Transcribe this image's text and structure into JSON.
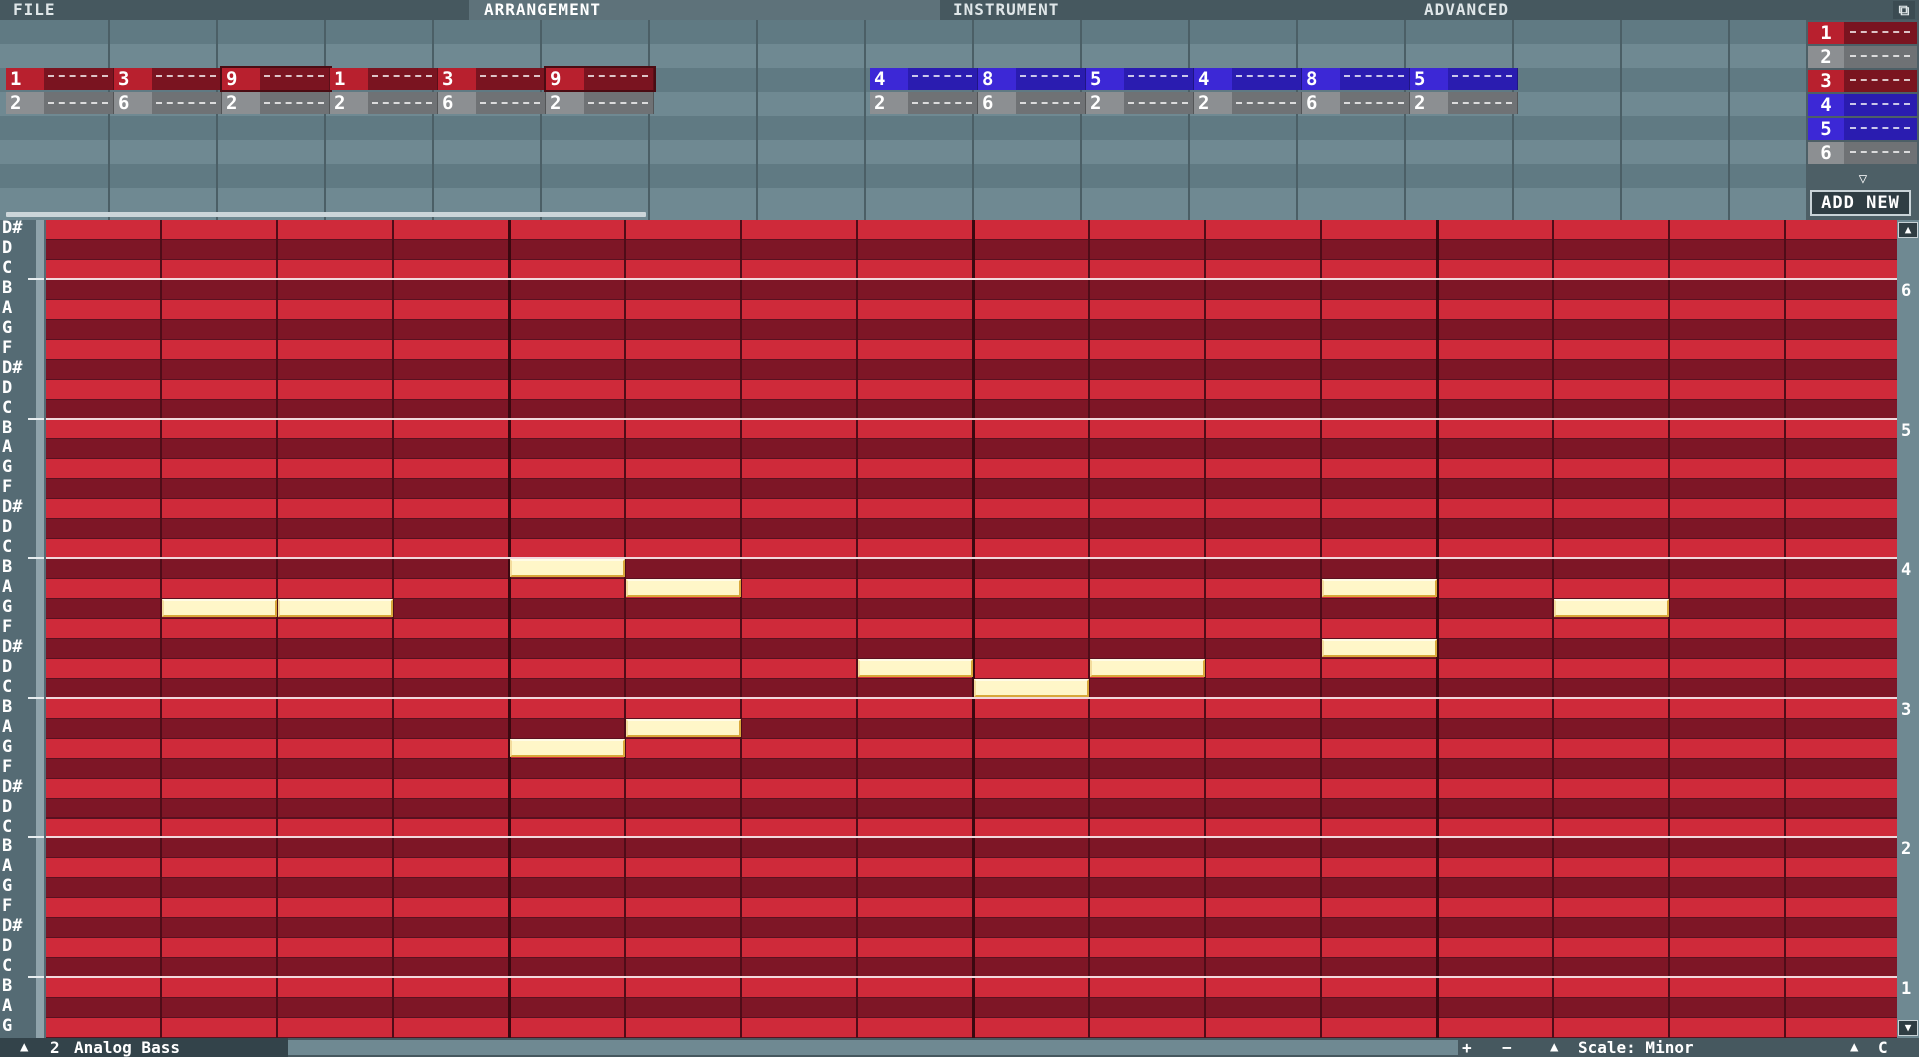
{
  "menu": {
    "tabs": [
      {
        "label": "FILE",
        "active": false
      },
      {
        "label": "ARRANGEMENT",
        "active": true
      },
      {
        "label": "INSTRUMENT",
        "active": false
      },
      {
        "label": "ADVANCED",
        "active": false
      }
    ],
    "window_icon": "maximize-icon"
  },
  "arrangement": {
    "rows": [
      [
        {
          "num": "1",
          "color": "red"
        },
        {
          "num": "3",
          "color": "red"
        },
        {
          "num": "9",
          "color": "red",
          "selected": true
        },
        {
          "num": "1",
          "color": "red"
        },
        {
          "num": "3",
          "color": "red"
        },
        {
          "num": "9",
          "color": "red",
          "selected": true
        },
        null,
        null,
        {
          "num": "4",
          "color": "blue"
        },
        {
          "num": "8",
          "color": "blue"
        },
        {
          "num": "5",
          "color": "blue"
        },
        {
          "num": "4",
          "color": "blue"
        },
        {
          "num": "8",
          "color": "blue"
        },
        {
          "num": "5",
          "color": "blue"
        }
      ],
      [
        {
          "num": "2",
          "color": "gray"
        },
        {
          "num": "6",
          "color": "gray"
        },
        {
          "num": "2",
          "color": "gray"
        },
        {
          "num": "2",
          "color": "gray"
        },
        {
          "num": "6",
          "color": "gray"
        },
        {
          "num": "2",
          "color": "gray"
        },
        null,
        null,
        {
          "num": "2",
          "color": "gray"
        },
        {
          "num": "6",
          "color": "gray"
        },
        {
          "num": "2",
          "color": "gray"
        },
        {
          "num": "2",
          "color": "gray"
        },
        {
          "num": "6",
          "color": "gray"
        },
        {
          "num": "2",
          "color": "gray"
        }
      ]
    ]
  },
  "pattern_list": {
    "items": [
      {
        "num": "1",
        "color": "red"
      },
      {
        "num": "2",
        "color": "gray"
      },
      {
        "num": "3",
        "color": "red"
      },
      {
        "num": "4",
        "color": "blue"
      },
      {
        "num": "5",
        "color": "blue"
      },
      {
        "num": "6",
        "color": "gray"
      }
    ],
    "add_new_label": "ADD NEW"
  },
  "piano_roll": {
    "key_labels": [
      "D#",
      "D",
      "C",
      "B",
      "A",
      "G",
      "F",
      "D#",
      "D",
      "C",
      "B",
      "A",
      "G",
      "F",
      "D#",
      "D",
      "C",
      "B",
      "A",
      "G",
      "F",
      "D#",
      "D",
      "C",
      "B",
      "A",
      "G",
      "F",
      "D#",
      "D",
      "C",
      "B",
      "A",
      "G",
      "F",
      "D#",
      "D",
      "C",
      "B",
      "A",
      "G"
    ],
    "octave_numbers": [
      "6",
      "5",
      "4",
      "3",
      "2",
      "1"
    ],
    "notes": [
      {
        "key_index": 19,
        "step": 1,
        "length": 1
      },
      {
        "key_index": 19,
        "step": 2,
        "length": 1
      },
      {
        "key_index": 17,
        "step": 4,
        "length": 1
      },
      {
        "key_index": 18,
        "step": 5,
        "length": 1
      },
      {
        "key_index": 22,
        "step": 7,
        "length": 1
      },
      {
        "key_index": 23,
        "step": 8,
        "length": 1
      },
      {
        "key_index": 22,
        "step": 9,
        "length": 1
      },
      {
        "key_index": 18,
        "step": 11,
        "length": 1
      },
      {
        "key_index": 21,
        "step": 11,
        "length": 1
      },
      {
        "key_index": 19,
        "step": 13,
        "length": 1
      },
      {
        "key_index": 26,
        "step": 4,
        "length": 1
      },
      {
        "key_index": 25,
        "step": 5,
        "length": 1
      }
    ]
  },
  "status": {
    "instrument_number": "2",
    "instrument_name": "Analog Bass",
    "plus": "+",
    "minus": "−",
    "scale_label": "Scale: Minor",
    "key": "C"
  }
}
